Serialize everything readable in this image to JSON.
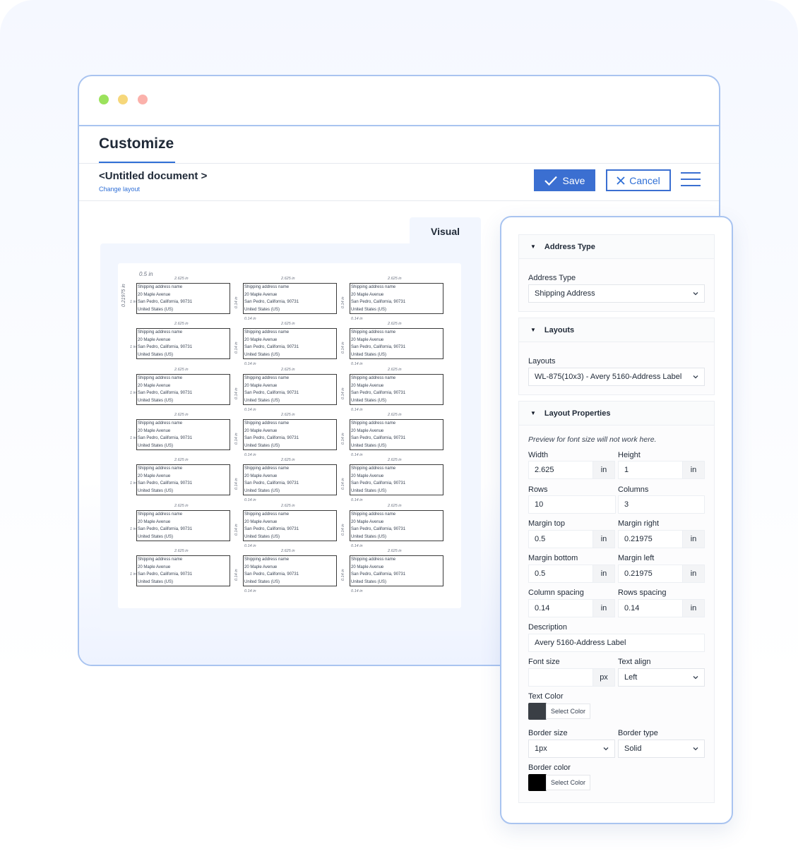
{
  "window": {
    "dots": [
      "#9be25c",
      "#f6d77a",
      "#fbb1ab"
    ]
  },
  "header": {
    "title": "Customize",
    "doc_title": "<Untitled document >",
    "change_layout": "Change layout"
  },
  "toolbar": {
    "save_label": "Save",
    "cancel_label": "Cancel"
  },
  "visual": {
    "tab_label": "Visual",
    "margin_top": "0.5 in",
    "margin_left": "0.21975 in",
    "label_width": "2.625 in",
    "label_height": "1 in",
    "column_spacing": "0.14 in",
    "row_spacing": "0.14 in",
    "label_lines": [
      "Shipping address name",
      "20 Maple Avenue",
      "San Pedro, California, 90731",
      "United States (US)"
    ]
  },
  "panel": {
    "address_type": {
      "heading": "Address Type",
      "field_label": "Address Type",
      "value": "Shipping Address"
    },
    "layouts": {
      "heading": "Layouts",
      "field_label": "Layouts",
      "value": "WL-875(10x3) - Avery 5160-Address Label"
    },
    "layout_properties": {
      "heading": "Layout Properties",
      "note": "Preview for font size will not work here.",
      "width_label": "Width",
      "width_value": "2.625",
      "width_unit": "in",
      "height_label": "Height",
      "height_value": "1",
      "height_unit": "in",
      "rows_label": "Rows",
      "rows_value": "10",
      "columns_label": "Columns",
      "columns_value": "3",
      "margin_top_label": "Margin top",
      "margin_top_value": "0.5",
      "margin_top_unit": "in",
      "margin_right_label": "Margin right",
      "margin_right_value": "0.21975",
      "margin_right_unit": "in",
      "margin_bottom_label": "Margin bottom",
      "margin_bottom_value": "0.5",
      "margin_bottom_unit": "in",
      "margin_left_label": "Margin left",
      "margin_left_value": "0.21975",
      "margin_left_unit": "in",
      "column_spacing_label": "Column spacing",
      "column_spacing_value": "0.14",
      "column_spacing_unit": "in",
      "rows_spacing_label": "Rows spacing",
      "rows_spacing_value": "0.14",
      "rows_spacing_unit": "in",
      "description_label": "Description",
      "description_value": "Avery 5160-Address Label",
      "font_size_label": "Font size",
      "font_size_value": "",
      "font_size_unit": "px",
      "text_align_label": "Text align",
      "text_align_value": "Left",
      "text_color_label": "Text Color",
      "text_color": "#3a3f45",
      "text_color_button": "Select Color",
      "border_size_label": "Border size",
      "border_size_value": "1px",
      "border_type_label": "Border type",
      "border_type_value": "Solid",
      "border_color_label": "Border color",
      "border_color": "#000000",
      "border_color_button": "Select Color"
    }
  },
  "colors": {
    "accent": "#3b6fd1",
    "window_border": "#a9c4f0"
  }
}
